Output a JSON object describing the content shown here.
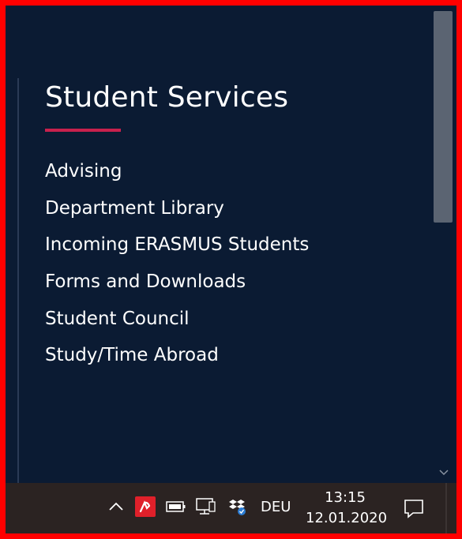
{
  "panel": {
    "title": "Student Services",
    "items": [
      {
        "label": "Advising"
      },
      {
        "label": "Department Library"
      },
      {
        "label": "Incoming ERASMUS Students"
      },
      {
        "label": "Forms and Downloads"
      },
      {
        "label": "Student Council"
      },
      {
        "label": "Study/Time Abroad"
      }
    ]
  },
  "taskbar": {
    "language": "DEU",
    "time": "13:15",
    "date": "12.01.2020",
    "icons": [
      "chevron-up-icon",
      "antivirus-icon",
      "battery-icon",
      "network-icon",
      "dropbox-icon",
      "notification-icon"
    ]
  },
  "colors": {
    "page_bg": "#0b1b33",
    "accent": "#c8214d",
    "taskbar_bg": "#2b2322",
    "frame": "#ff0000",
    "antivirus": "#e0202a"
  }
}
